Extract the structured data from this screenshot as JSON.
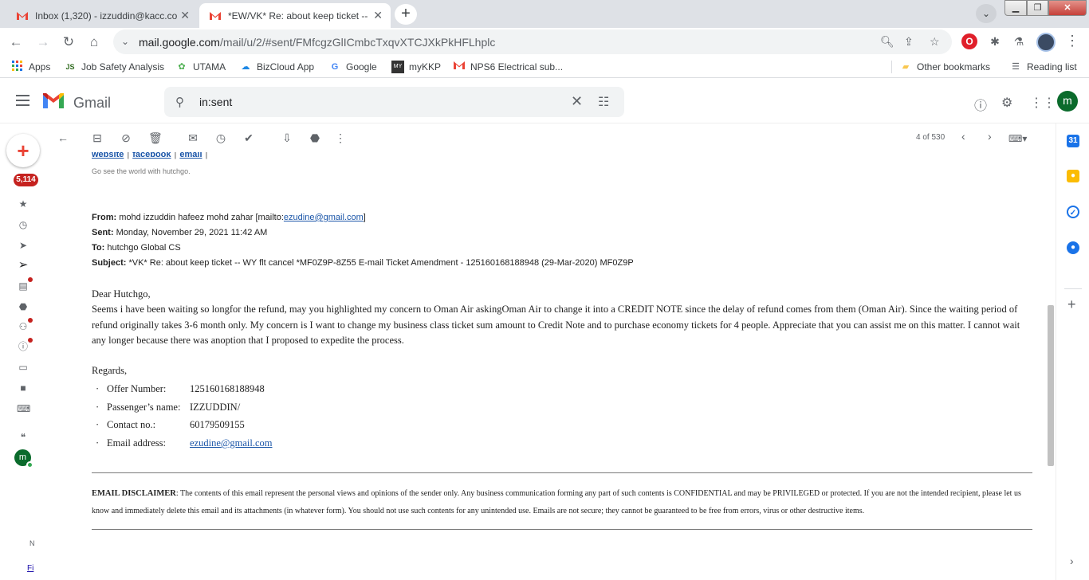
{
  "browser": {
    "tabs": [
      {
        "title": "Inbox (1,320) - izzuddin@kacc.co",
        "active": false
      },
      {
        "title": "*EW/VK* Re: about keep ticket -- ",
        "active": true
      }
    ],
    "new_tab": "+",
    "url_host": "mail.google.com",
    "url_path": "/mail/u/2/#sent/FMfcgzGlICmbcTxqvXTCJXkPkHFLhplc",
    "bookmarks": [
      {
        "label": "Apps",
        "icon": "apps-grid-icon"
      },
      {
        "label": "Job Safety Analysis",
        "icon": "jsa-icon"
      },
      {
        "label": "UTAMA",
        "icon": "utama-icon"
      },
      {
        "label": "BizCloud App",
        "icon": "bizcloud-icon"
      },
      {
        "label": "Google",
        "icon": "google-icon"
      },
      {
        "label": "myKKP",
        "icon": "mykkp-icon"
      },
      {
        "label": "NPS6 Electrical sub...",
        "icon": "gmail-icon"
      }
    ],
    "other_bookmarks": "Other bookmarks",
    "reading_list": "Reading list"
  },
  "gmail": {
    "brand": "Gmail",
    "search_value": "in:sent",
    "avatar_letter": "m",
    "unread_badge": "5,114",
    "pager": "4 of 530"
  },
  "email": {
    "links": [
      "website",
      "facebook",
      "email"
    ],
    "tagline": "Go see the world with hutchgo.",
    "from_label": "From:",
    "from_value": "mohd izzuddin hafeez mohd zahar [mailto:",
    "from_email": "ezudine@gmail.com",
    "from_end": "]",
    "sent_label": "Sent:",
    "sent_value": "Monday, November 29, 2021 11:42 AM",
    "to_label": "To:",
    "to_value": "hutchgo Global CS",
    "subject_label": "Subject:",
    "subject_value": "*VK* Re: about keep ticket -- WY flt cancel *MF0Z9P-8Z55 E-mail Ticket Amendment - 125160168188948 (29-Mar-2020) MF0Z9P",
    "greeting": "Dear Hutchgo,",
    "body": "Seems i have been waiting so longfor the refund, may you highlighted my concern to Oman Air askingOman Air to change it into a CREDIT NOTE since the delay of refund comes from them (Oman Air). Since the waiting period of refund originally takes 3-6 month only. My concern is I want to change my business class ticket sum amount to Credit Note and to purchase economy tickets for 4 people. Appreciate that you can assist me on this matter. I cannot wait any longer because there was anoption that I proposed to expedite the process.",
    "regards": "Regards,",
    "details": [
      {
        "label": "Offer Number:",
        "value": "125160168188948"
      },
      {
        "label": "Passenger’s name:",
        "value": "IZZUDDIN/"
      },
      {
        "label": "Contact no.:",
        "value": "60179509155"
      },
      {
        "label": "Email address:",
        "value": "ezudine@gmail.com"
      }
    ],
    "disclaimer_title": "EMAIL DISCLAIMER",
    "disclaimer_text": ": The contents of this email represent the personal views and opinions of the sender only. Any business communication forming any part of such contents is CONFIDENTIAL and may be PRIVILEGED or protected. If you are not the intended recipient, please let us know and immediately delete this email and its attachments (in whatever form). You should not use such contents for any unintended use. Emails are not secure; they cannot be guaranteed to be free from errors, virus or other destructive items."
  },
  "rail": {
    "n_text": "N",
    "fi_text": "Fi"
  },
  "colors": {
    "gmail_red": "#ea4335",
    "badge_red": "#c5221f",
    "avatar_green": "#0b6b2c",
    "link_blue": "#1a55a8"
  }
}
